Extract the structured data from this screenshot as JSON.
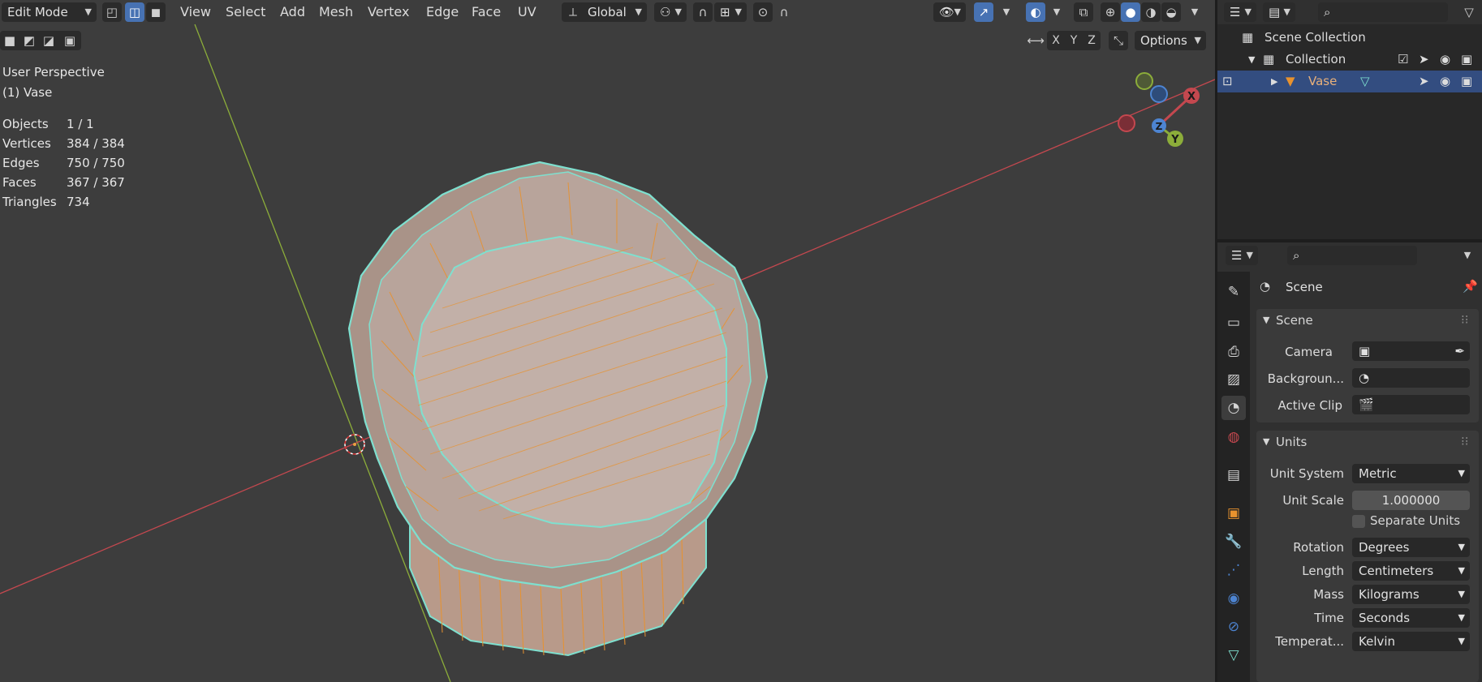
{
  "header": {
    "mode": "Edit Mode",
    "menus": [
      "View",
      "Select",
      "Add",
      "Mesh",
      "Vertex",
      "Edge",
      "Face",
      "UV"
    ],
    "transform_orientation": "Global",
    "options_label": "Options",
    "axis_x": "X",
    "axis_y": "Y",
    "axis_z": "Z"
  },
  "overlay": {
    "view_name": "User Perspective",
    "object_name": "(1) Vase",
    "stats": [
      {
        "label": "Objects",
        "value": "1 / 1"
      },
      {
        "label": "Vertices",
        "value": "384 / 384"
      },
      {
        "label": "Edges",
        "value": "750 / 750"
      },
      {
        "label": "Faces",
        "value": "367 / 367"
      },
      {
        "label": "Triangles",
        "value": "734"
      }
    ]
  },
  "gizmo": {
    "x": "X",
    "y": "Y",
    "z": "Z"
  },
  "outliner": {
    "rows": [
      {
        "label": "Scene Collection"
      },
      {
        "label": "Collection"
      },
      {
        "label": "Vase"
      }
    ]
  },
  "properties": {
    "context_title": "Scene",
    "scene_panel": {
      "title": "Scene",
      "camera_label": "Camera",
      "background_label": "Backgroun...",
      "active_clip_label": "Active Clip"
    },
    "units_panel": {
      "title": "Units",
      "unit_system_label": "Unit System",
      "unit_system_value": "Metric",
      "unit_scale_label": "Unit Scale",
      "unit_scale_value": "1.000000",
      "separate_units_label": "Separate Units",
      "rotation_label": "Rotation",
      "rotation_value": "Degrees",
      "length_label": "Length",
      "length_value": "Centimeters",
      "mass_label": "Mass",
      "mass_value": "Kilograms",
      "time_label": "Time",
      "time_value": "Seconds",
      "temperature_label": "Temperat...",
      "temperature_value": "Kelvin"
    }
  },
  "colors": {
    "viewport_bg": "#3d3d3d",
    "x_axis": "#c4484f",
    "y_axis": "#8cad3a",
    "selected_edge": "#7ee0cf",
    "edge": "#e8922e",
    "active_blue": "#4772b3"
  }
}
